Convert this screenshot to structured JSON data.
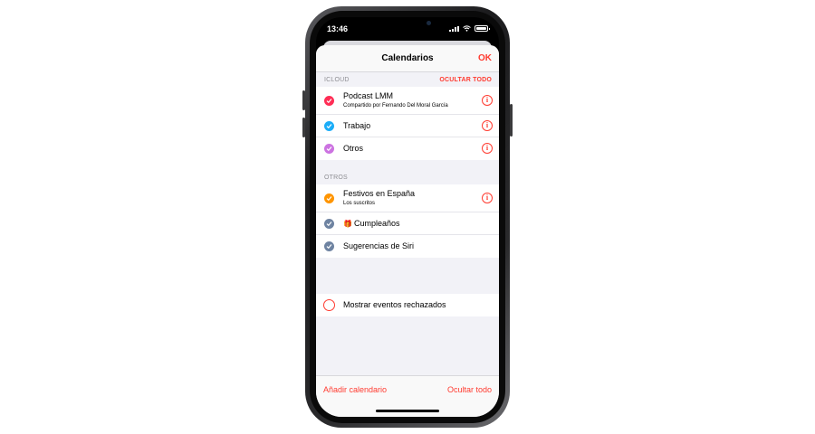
{
  "status_bar": {
    "time": "13:46"
  },
  "nav": {
    "title": "Calendarios",
    "done_label": "OK"
  },
  "sections": {
    "icloud": {
      "label": "ICLOUD",
      "action": "OCULTAR TODO"
    },
    "otros": {
      "label": "OTROS"
    }
  },
  "icloud_items": [
    {
      "title": "Podcast LMM",
      "subtitle": "Compartido por Fernando Del Moral García",
      "color": "#ff2d55"
    },
    {
      "title": "Trabajo",
      "color": "#1badf8"
    },
    {
      "title": "Otros",
      "color": "#cc73e1"
    }
  ],
  "otros_items": [
    {
      "title": "Festivos en España",
      "subtitle": "Los suscritos",
      "color": "#ff9500"
    },
    {
      "title": "Cumpleaños",
      "color": "#6e83a1"
    },
    {
      "title": "Sugerencias de Siri",
      "color": "#6e83a1"
    }
  ],
  "declined": {
    "label": "Mostrar eventos rechazados"
  },
  "toolbar": {
    "add_label": "Añadir calendario",
    "hide_label": "Ocultar todo"
  },
  "icons": {
    "check": "checkmark-icon",
    "info": "info-icon",
    "gift": "gift-icon"
  },
  "colors": {
    "accent": "#ff3b30"
  }
}
